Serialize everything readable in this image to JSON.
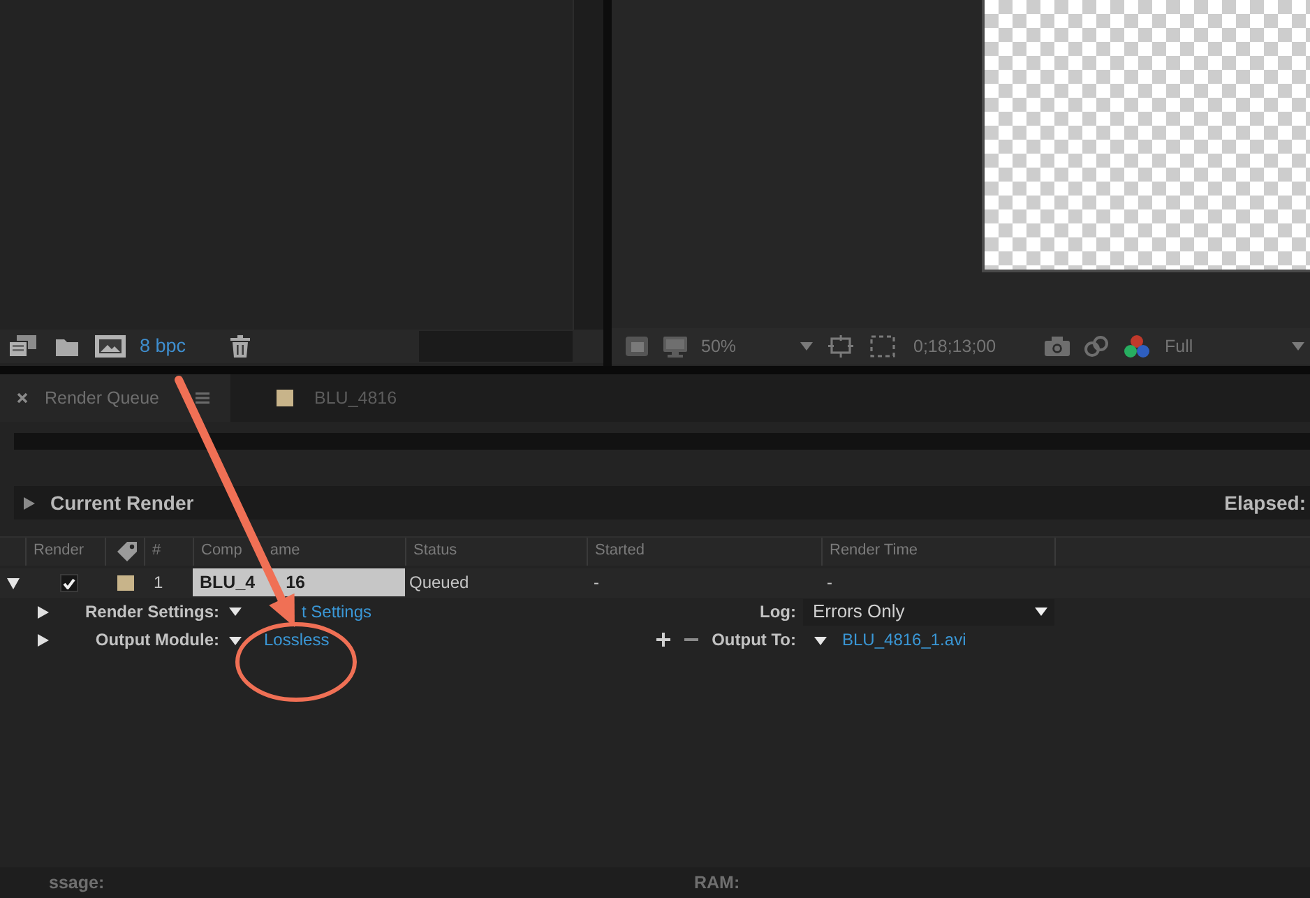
{
  "project_panel": {
    "bit_depth": "8 bpc"
  },
  "viewer": {
    "zoom": "50%",
    "timecode": "0;18;13;00",
    "resolution": "Full"
  },
  "tabs": [
    {
      "label": "Render Queue",
      "selected": true
    },
    {
      "label": "BLU_4816",
      "selected": false,
      "color": "#c8b48a"
    }
  ],
  "current_render": {
    "title": "Current Render",
    "expanded": false,
    "elapsed": "Elapsed:"
  },
  "columns": [
    {
      "kind": "text",
      "parts": [
        "Render"
      ]
    },
    {
      "kind": "icon"
    },
    {
      "kind": "text",
      "parts": [
        "#"
      ]
    },
    {
      "kind": "text",
      "parts": [
        "Comp",
        "ame"
      ]
    },
    {
      "kind": "text",
      "parts": [
        "Status"
      ]
    },
    {
      "kind": "text",
      "parts": [
        "Started"
      ]
    },
    {
      "kind": "text",
      "parts": [
        "Render Time"
      ]
    }
  ],
  "rows": [
    {
      "selected": true,
      "expanded": true,
      "render": true,
      "color": "#c8b48a",
      "number": "1",
      "comp_name": [
        "BLU_4",
        "16"
      ],
      "status": "Queued",
      "started": "-",
      "render_time": "-",
      "render_settings": {
        "label": "Render Settings:",
        "expanded": false,
        "value": "t Settings"
      },
      "log": {
        "label": "Log:",
        "value": "Errors Only"
      },
      "output_module": {
        "label": "Output Module:",
        "expanded": false,
        "value": "Lossless"
      },
      "output_to": {
        "label": "Output To:",
        "value": "BLU_4816_1.avi"
      }
    }
  ],
  "status_bar": {
    "message": "ssage:",
    "ram": "RAM:"
  }
}
